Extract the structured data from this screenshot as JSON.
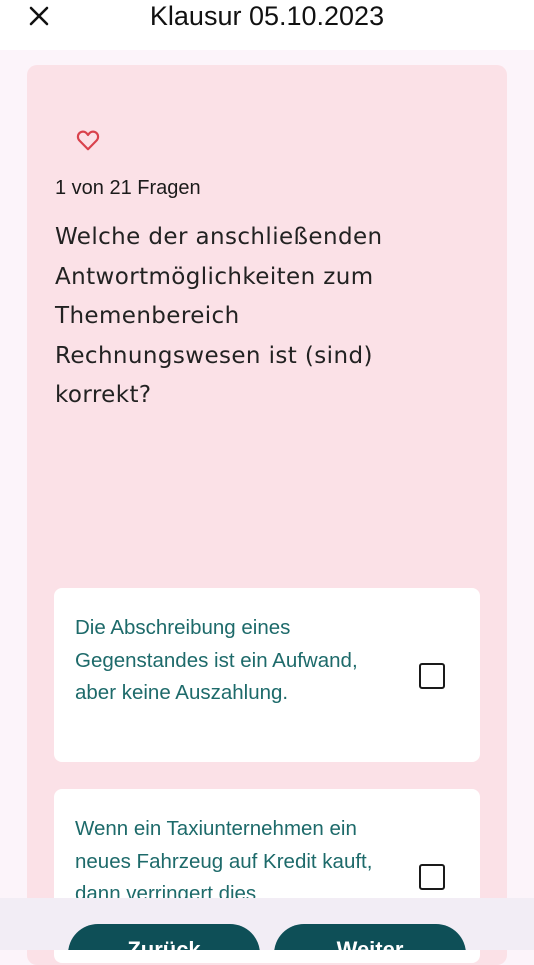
{
  "header": {
    "title": "Klausur 05.10.2023",
    "close_icon": "close-icon"
  },
  "question": {
    "favorite_icon": "heart-outline-icon",
    "counter": "1 von 21 Fragen",
    "text": "Welche der anschließenden Antwortmöglichkeiten zum Themenbereich Rechnungswesen ist (sind) korrekt?"
  },
  "answers": [
    {
      "text": "Die Abschreibung eines Gegenstandes ist ein Aufwand, aber keine Auszahlung.",
      "checked": false
    },
    {
      "text": "Wenn ein Taxiunternehmen ein neues Fahrzeug auf Kredit kauft, dann verringert dies",
      "checked": false
    }
  ],
  "nav": {
    "back_label": "Zurück",
    "next_label": "Weiter"
  },
  "colors": {
    "card_background": "#fbe1e7",
    "answer_text": "#1d6a6a",
    "button": "#0e4f57",
    "heart": "#d9424d"
  }
}
